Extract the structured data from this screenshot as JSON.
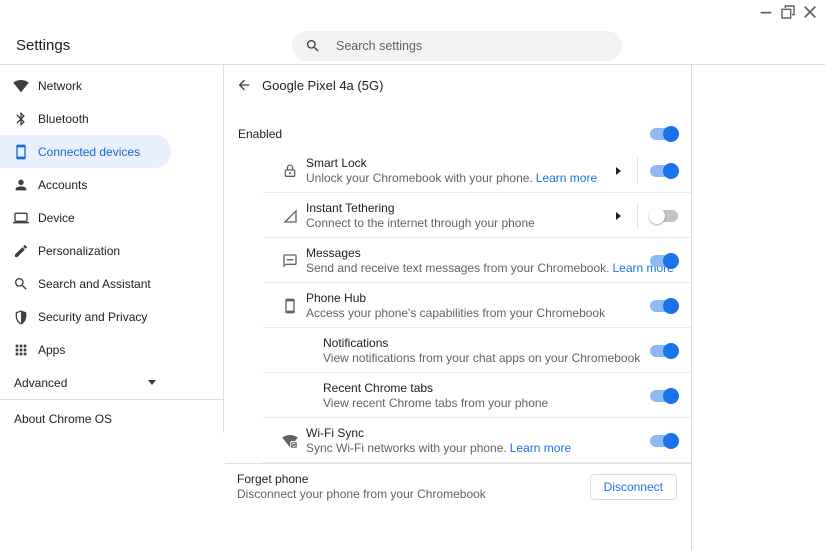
{
  "window": {
    "title": "Settings"
  },
  "titlebar_controls": {
    "minimize": "minimize-icon",
    "restore": "restore-icon",
    "close": "close-icon"
  },
  "search": {
    "placeholder": "Search settings"
  },
  "sidebar": {
    "items": [
      {
        "label": "Network",
        "icon": "wifi-icon",
        "selected": false
      },
      {
        "label": "Bluetooth",
        "icon": "bluetooth-icon",
        "selected": false
      },
      {
        "label": "Connected devices",
        "icon": "smartphone-icon",
        "selected": true
      },
      {
        "label": "Accounts",
        "icon": "person-icon",
        "selected": false
      },
      {
        "label": "Device",
        "icon": "laptop-icon",
        "selected": false
      },
      {
        "label": "Personalization",
        "icon": "pen-icon",
        "selected": false
      },
      {
        "label": "Search and Assistant",
        "icon": "search-icon",
        "selected": false
      },
      {
        "label": "Security and Privacy",
        "icon": "shield-icon",
        "selected": false
      },
      {
        "label": "Apps",
        "icon": "apps-grid-icon",
        "selected": false
      }
    ],
    "advanced_label": "Advanced",
    "about_label": "About Chrome OS"
  },
  "page": {
    "title": "Google Pixel 4a (5G)",
    "enabled_row": {
      "label": "Enabled",
      "toggle": "on"
    },
    "rows": [
      {
        "title": "Smart Lock",
        "subtitle": "Unlock your Chromebook with your phone.",
        "link": "Learn more",
        "icon": "lock-icon",
        "toggle": "on",
        "detail_arrow": true,
        "indent": false
      },
      {
        "title": "Instant Tethering",
        "subtitle": "Connect to the internet through your phone",
        "link": "",
        "icon": "cell-signal-icon",
        "toggle": "off",
        "detail_arrow": true,
        "indent": false
      },
      {
        "title": "Messages",
        "subtitle": "Send and receive text messages from your Chromebook.",
        "link": "Learn more",
        "icon": "message-icon",
        "toggle": "on",
        "detail_arrow": false,
        "indent": false
      },
      {
        "title": "Phone Hub",
        "subtitle": "Access your phone's capabilities from your Chromebook",
        "link": "",
        "icon": "smartphone-icon",
        "toggle": "on",
        "detail_arrow": false,
        "indent": false
      },
      {
        "title": "Notifications",
        "subtitle": "View notifications from your chat apps on your Chromebook",
        "link": "",
        "icon": "",
        "toggle": "on",
        "detail_arrow": false,
        "indent": true
      },
      {
        "title": "Recent Chrome tabs",
        "subtitle": "View recent Chrome tabs from your phone",
        "link": "",
        "icon": "",
        "toggle": "on",
        "detail_arrow": false,
        "indent": true
      },
      {
        "title": "Wi-Fi Sync",
        "subtitle": "Sync Wi-Fi networks with your phone.",
        "link": "Learn more",
        "icon": "wifi-sync-icon",
        "toggle": "on",
        "detail_arrow": false,
        "indent": false
      }
    ],
    "footer": {
      "title": "Forget phone",
      "subtitle": "Disconnect your phone from your Chromebook",
      "button_label": "Disconnect"
    }
  },
  "colors": {
    "accent": "#1A73E8",
    "selected_nav_text": "#1967D2",
    "selected_nav_bg": "#E8F0FE",
    "toggle_track_on": "#8CB9F3",
    "toggle_track_off": "#C0C4C9",
    "link": "#1A73E8",
    "subtitle_text": "#5F6368"
  }
}
